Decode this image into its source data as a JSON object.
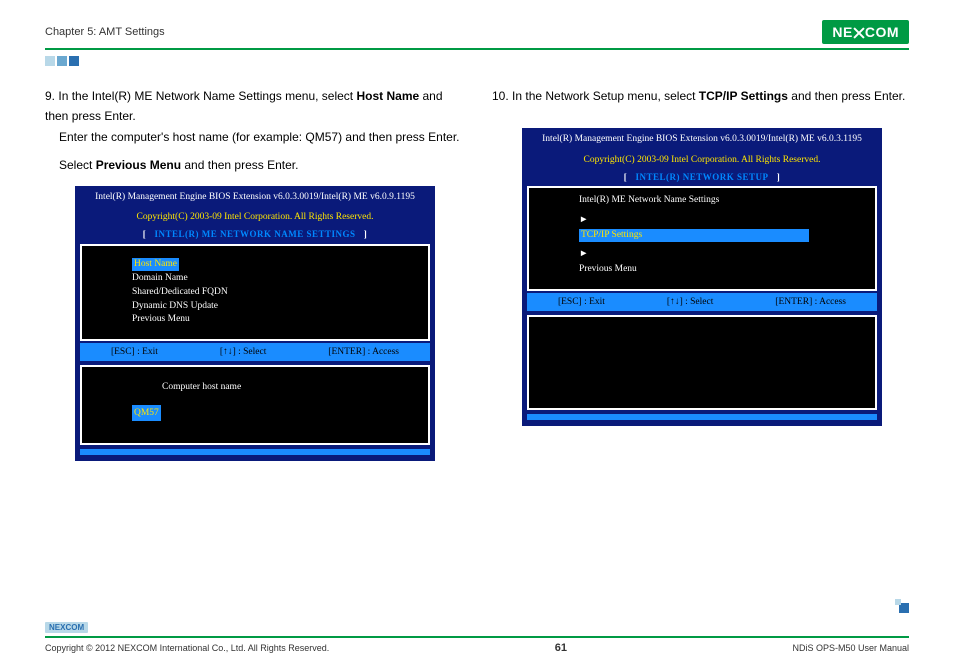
{
  "header": {
    "chapter": "Chapter 5: AMT Settings",
    "logo_text_left": "NE",
    "logo_text_right": "COM"
  },
  "left": {
    "step_num": "9.",
    "line1a": "In the Intel(R) ME Network Name Settings menu, select ",
    "line1b": "Host Name",
    "line1c": " and then press Enter.",
    "line2": "Enter the computer's host name (for example: QM57) and then press Enter.",
    "line3a": "Select ",
    "line3b": "Previous Menu",
    "line3c": " and then press Enter.",
    "bios": {
      "top": "Intel(R) Management Engine BIOS Extension v6.0.3.0019/Intel(R) ME v6.0.9.1195",
      "copyright": "Copyright(C) 2003-09 Intel Corporation. All Rights Reserved.",
      "title": "INTEL(R) ME NETWORK NAME SETTINGS",
      "items": [
        "Host Name",
        "Domain Name",
        "Shared/Dedicated FQDN",
        "Dynamic DNS Update",
        "Previous Menu"
      ],
      "keys": {
        "esc": "[ESC] : Exit",
        "arrows": "[↑↓] : Select",
        "enter": "[ENTER] : Access"
      },
      "lower_label": "Computer host name",
      "lower_value": "QM57"
    }
  },
  "right": {
    "step_num": "10.",
    "line1a": "In the Network Setup menu, select ",
    "line1b": "TCP/IP Settings",
    "line1c": " and then press Enter.",
    "bios": {
      "top": "Intel(R) Management Engine BIOS Extension v6.0.3.0019/Intel(R) ME v6.0.3.1195",
      "copyright": "Copyright(C) 2003-09 Intel Corporation. All Rights Reserved.",
      "title": "INTEL(R) NETWORK SETUP",
      "items": [
        "Intel(R) ME Network Name Settings",
        "TCP/IP Settings",
        "Previous Menu"
      ],
      "keys": {
        "esc": "[ESC] : Exit",
        "arrows": "[↑↓] : Select",
        "enter": "[ENTER] : Access"
      }
    }
  },
  "footer": {
    "logo": "NEXCOM",
    "copyright": "Copyright © 2012 NEXCOM International Co., Ltd. All Rights Reserved.",
    "page": "61",
    "manual": "NDiS OPS-M50 User Manual"
  }
}
